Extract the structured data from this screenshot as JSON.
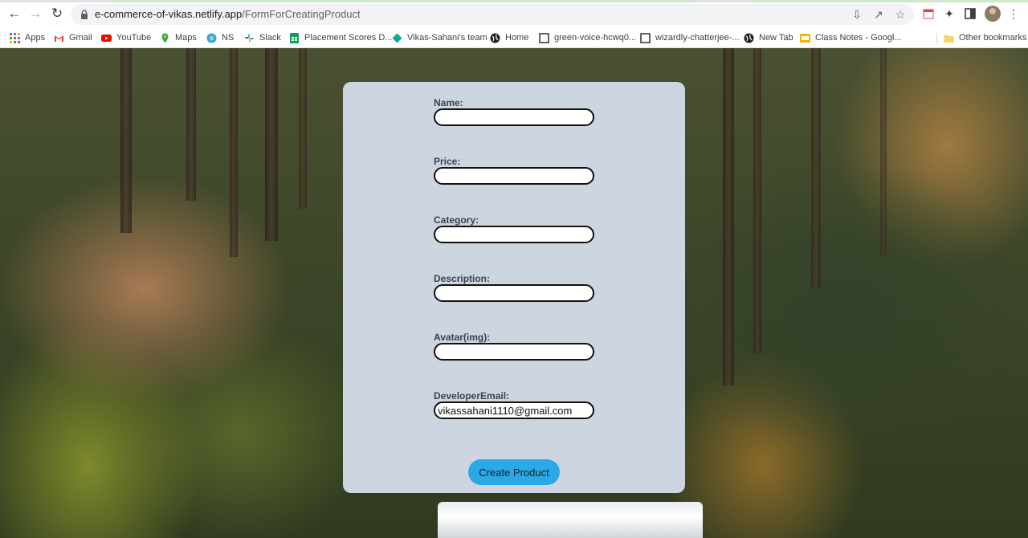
{
  "browser": {
    "url_host": "e-commerce-of-vikas.netlify.app",
    "url_path": "/FormForCreatingProduct",
    "bookmarks": [
      {
        "label": "Apps",
        "icon": "apps-grid-icon"
      },
      {
        "label": "Gmail",
        "icon": "gmail-icon"
      },
      {
        "label": "YouTube",
        "icon": "youtube-icon"
      },
      {
        "label": "Maps",
        "icon": "maps-icon"
      },
      {
        "label": "NS",
        "icon": "globe-icon"
      },
      {
        "label": "Slack",
        "icon": "slack-icon"
      },
      {
        "label": "Placement Scores D...",
        "icon": "sheets-icon"
      },
      {
        "label": "Vikas-Sahani's team",
        "icon": "diamond-icon"
      },
      {
        "label": "Home",
        "icon": "globe-icon"
      },
      {
        "label": "green-voice-hcwq0...",
        "icon": "page-icon"
      },
      {
        "label": "wizardly-chatterjee-...",
        "icon": "page-icon"
      },
      {
        "label": "New Tab",
        "icon": "globe-icon"
      },
      {
        "label": "Class Notes - Googl...",
        "icon": "slides-icon"
      }
    ],
    "other_bookmarks": "Other bookmarks"
  },
  "form": {
    "fields": [
      {
        "label": "Name:",
        "value": ""
      },
      {
        "label": "Price:",
        "value": ""
      },
      {
        "label": "Category:",
        "value": ""
      },
      {
        "label": "Description:",
        "value": ""
      },
      {
        "label": "Avatar(img):",
        "value": ""
      },
      {
        "label": "DeveloperEmail:",
        "value": "vikassahani1110@gmail.com"
      }
    ],
    "submit_label": "Create Product"
  },
  "colors": {
    "card_bg": "#ccd5e0",
    "button_bg": "#2aa9e6",
    "input_border": "#111111"
  }
}
